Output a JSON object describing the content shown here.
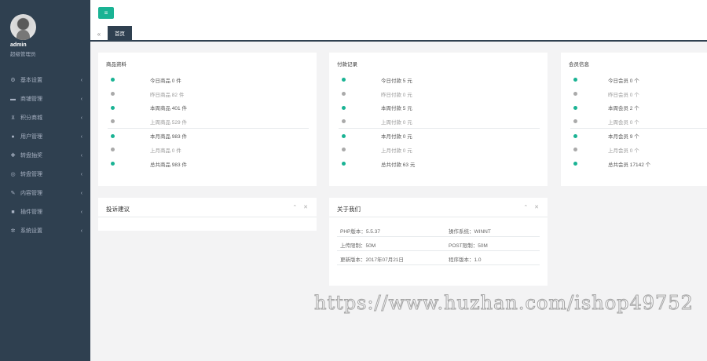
{
  "user": {
    "name": "admin",
    "role": "超级管理员"
  },
  "sidebar": {
    "items": [
      {
        "label": "基本设置",
        "icon": "gear-icon"
      },
      {
        "label": "商铺管理",
        "icon": "folder-icon"
      },
      {
        "label": "积分商城",
        "icon": "cart-icon"
      },
      {
        "label": "用户管理",
        "icon": "user-icon"
      },
      {
        "label": "转盘抽奖",
        "icon": "gift-icon"
      },
      {
        "label": "转盘管理",
        "icon": "circle-icon"
      },
      {
        "label": "内容管理",
        "icon": "edit-icon"
      },
      {
        "label": "插件管理",
        "icon": "plugin-icon"
      },
      {
        "label": "系统设置",
        "icon": "cogs-icon"
      }
    ]
  },
  "topbar": {
    "toggle_glyph": "≡"
  },
  "tabs": {
    "back_glyph": "«",
    "active": "首页"
  },
  "panels": {
    "products": {
      "title": "商品资料",
      "rows": [
        {
          "text": "今日商品 0 件",
          "status": "green"
        },
        {
          "text": "昨日商品 82 件",
          "status": "gray"
        },
        {
          "text": "本周商品 401 件",
          "status": "green"
        },
        {
          "text": "上周商品 529 件",
          "status": "gray"
        },
        {
          "text": "本月商品 983 件",
          "status": "green"
        },
        {
          "text": "上月商品 0 件",
          "status": "gray"
        },
        {
          "text": "总共商品 983 件",
          "status": "green"
        }
      ]
    },
    "payments": {
      "title": "付款记录",
      "rows": [
        {
          "text": "今日付款 5 元",
          "status": "green"
        },
        {
          "text": "昨日付款 0 元",
          "status": "gray"
        },
        {
          "text": "本周付款 5 元",
          "status": "green"
        },
        {
          "text": "上周付款 0 元",
          "status": "gray"
        },
        {
          "text": "本月付款 0 元",
          "status": "green"
        },
        {
          "text": "上月付款 0 元",
          "status": "gray"
        },
        {
          "text": "总共付款 63 元",
          "status": "green"
        }
      ]
    },
    "members": {
      "title": "会员信息",
      "rows": [
        {
          "text": "今日会员 0 个",
          "status": "green"
        },
        {
          "text": "昨日会员 0 个",
          "status": "gray"
        },
        {
          "text": "本周会员 2 个",
          "status": "green"
        },
        {
          "text": "上周会员 0 个",
          "status": "gray"
        },
        {
          "text": "本月会员 9 个",
          "status": "green"
        },
        {
          "text": "上月会员 0 个",
          "status": "gray"
        },
        {
          "text": "总共会员 17142 个",
          "status": "green"
        }
      ]
    },
    "feedback": {
      "title": "投诉建议",
      "tools": "⌃ ✕"
    },
    "about": {
      "title": "关于我们",
      "tools": "⌃ ✕",
      "rows": [
        [
          "PHP版本：5.5.37",
          "操作系统：WINNT"
        ],
        [
          "上传限制：50M",
          "POST限制：50M"
        ],
        [
          "更新版本：2017年07月21日",
          "程序版本：1.0"
        ]
      ]
    }
  },
  "watermark": "https://www.huzhan.com/ishop49752",
  "colors": {
    "sidebar": "#2f4050",
    "accent": "#1ab394",
    "background": "#f3f3f4"
  }
}
